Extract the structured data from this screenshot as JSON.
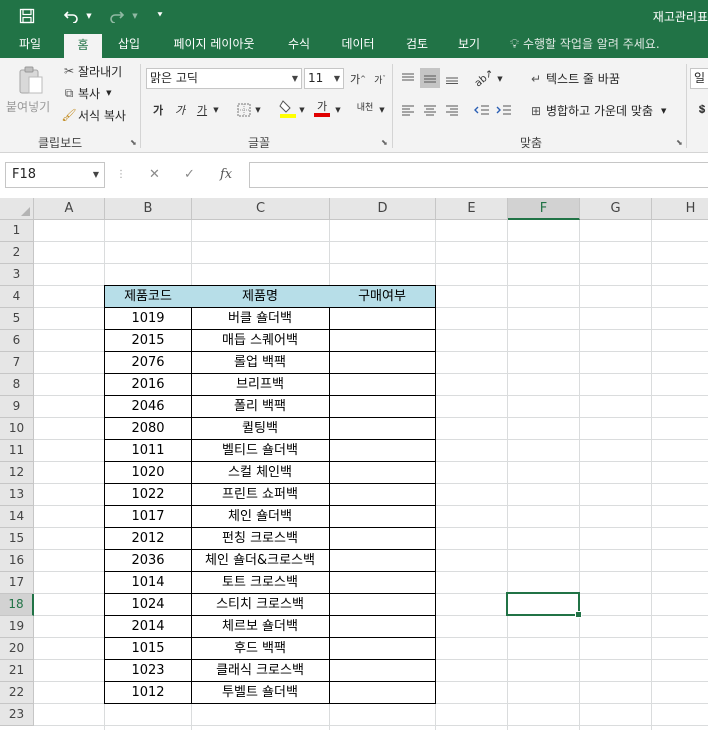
{
  "titlebar": {
    "doc_title": "재고관리표",
    "save_icon": "save-icon",
    "undo_icon": "undo-icon",
    "redo_icon": "redo-icon",
    "customize_icon": "customize-quick-access-icon"
  },
  "tabs": [
    {
      "label": "파일"
    },
    {
      "label": "홈"
    },
    {
      "label": "삽입"
    },
    {
      "label": "페이지 레이아웃"
    },
    {
      "label": "수식"
    },
    {
      "label": "데이터"
    },
    {
      "label": "검토"
    },
    {
      "label": "보기"
    }
  ],
  "tell_me": "수행할 작업을 알려 주세요.",
  "ribbon": {
    "clipboard": {
      "paste": "붙여넣기",
      "cut": "잘라내기",
      "copy": "복사",
      "format_painter": "서식 복사",
      "group": "클립보드"
    },
    "font": {
      "font_name": "맑은 고딕",
      "font_size": "11",
      "increase": "가",
      "decrease": "가",
      "bold": "가",
      "italic": "가",
      "underline": "가",
      "font_color_glyph": "가",
      "phonetic": "내천",
      "group": "글꼴"
    },
    "alignment": {
      "wrap_text": "텍스트 줄 바꿈",
      "merge_center": "병합하고 가운데 맞춤",
      "group": "맞춤"
    },
    "number": {
      "format_partial": "일"
    }
  },
  "formula_bar": {
    "name_box": "F18",
    "fx": "fx",
    "formula": ""
  },
  "grid": {
    "columns": [
      "A",
      "B",
      "C",
      "D",
      "E",
      "F",
      "G",
      "H"
    ],
    "selected_column": "F",
    "selected_row": 18,
    "rows": [
      "1",
      "2",
      "3",
      "4",
      "5",
      "6",
      "7",
      "8",
      "9",
      "10",
      "11",
      "12",
      "13",
      "14",
      "15",
      "16",
      "17",
      "18",
      "19",
      "20",
      "21",
      "22",
      "23"
    ]
  },
  "table": {
    "headers": [
      "제품코드",
      "제품명",
      "구매여부"
    ],
    "header_color": "#b7dee8",
    "rows": [
      {
        "code": "1019",
        "name": "버클 숄더백",
        "purchase": ""
      },
      {
        "code": "2015",
        "name": "매듭 스퀘어백",
        "purchase": ""
      },
      {
        "code": "2076",
        "name": "롤업 백팩",
        "purchase": ""
      },
      {
        "code": "2016",
        "name": "브리프백",
        "purchase": ""
      },
      {
        "code": "2046",
        "name": "폴리 백팩",
        "purchase": ""
      },
      {
        "code": "2080",
        "name": "퀼팅백",
        "purchase": ""
      },
      {
        "code": "1011",
        "name": "벨티드 숄더백",
        "purchase": ""
      },
      {
        "code": "1020",
        "name": "스컬 체인백",
        "purchase": ""
      },
      {
        "code": "1022",
        "name": "프린트 쇼퍼백",
        "purchase": ""
      },
      {
        "code": "1017",
        "name": "체인 숄더백",
        "purchase": ""
      },
      {
        "code": "2012",
        "name": "펀칭 크로스백",
        "purchase": ""
      },
      {
        "code": "2036",
        "name": "체인 숄더&크로스백",
        "purchase": ""
      },
      {
        "code": "1014",
        "name": "토트 크로스백",
        "purchase": ""
      },
      {
        "code": "1024",
        "name": "스티치 크로스백",
        "purchase": ""
      },
      {
        "code": "2014",
        "name": "체르보 숄더백",
        "purchase": ""
      },
      {
        "code": "1015",
        "name": "후드 백팩",
        "purchase": ""
      },
      {
        "code": "1023",
        "name": "클래식 크로스백",
        "purchase": ""
      },
      {
        "code": "1012",
        "name": "투벨트 숄더백",
        "purchase": ""
      }
    ]
  },
  "colors": {
    "accent": "#217346",
    "ribbon_bg": "#f3f3f3",
    "header_bg": "#e6e6e6"
  }
}
